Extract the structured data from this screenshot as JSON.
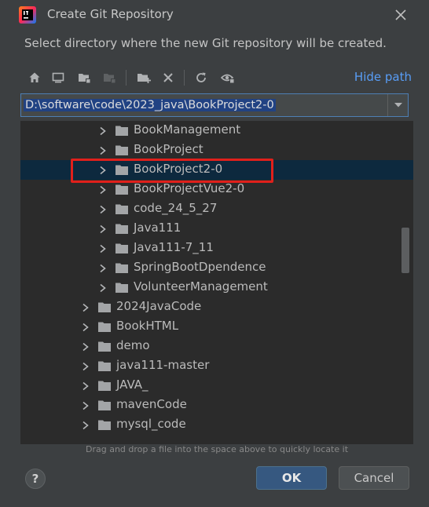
{
  "window": {
    "title": "Create Git Repository",
    "description": "Select directory where the new Git repository will be created."
  },
  "toolbar": {
    "buttons": [
      "home-icon",
      "desktop-icon",
      "project-folder-icon",
      "module-folder-icon",
      "new-folder-icon",
      "delete-icon",
      "refresh-icon",
      "show-hidden-icon"
    ],
    "hide_path_label": "Hide path"
  },
  "path": {
    "value": "D:\\software\\code\\2023_java\\BookProject2-0"
  },
  "tree": {
    "items": [
      {
        "label": "BookManagement",
        "level": 2
      },
      {
        "label": "BookProject",
        "level": 2
      },
      {
        "label": "BookProject2-0",
        "level": 2,
        "selected": true
      },
      {
        "label": "BookProjectVue2-0",
        "level": 2
      },
      {
        "label": "code_24_5_27",
        "level": 2
      },
      {
        "label": "Java111",
        "level": 2
      },
      {
        "label": "Java111-7_11",
        "level": 2
      },
      {
        "label": "SpringBootDpendence",
        "level": 2
      },
      {
        "label": "VolunteerManagement",
        "level": 2
      },
      {
        "label": "2024JavaCode",
        "level": 1
      },
      {
        "label": "BookHTML",
        "level": 1
      },
      {
        "label": "demo",
        "level": 1
      },
      {
        "label": "java111-master",
        "level": 1
      },
      {
        "label": "JAVA_",
        "level": 1
      },
      {
        "label": "mavenCode",
        "level": 1
      },
      {
        "label": "mysql_code",
        "level": 1
      }
    ]
  },
  "hint": "Drag and drop a file into the space above to quickly locate it",
  "buttons": {
    "help_label": "?",
    "ok_label": "OK",
    "cancel_label": "Cancel"
  },
  "colors": {
    "accent": "#589df6",
    "selection": "#0d293e",
    "highlight": "#e0201b",
    "ok_button": "#365880"
  }
}
